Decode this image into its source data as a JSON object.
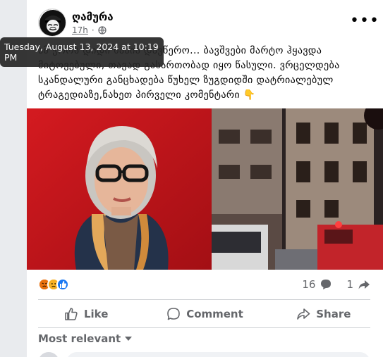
{
  "post": {
    "page_name": "ღამურა",
    "time": "17h",
    "text": "ამ ჭორს დიდი ხანია დავწერო... ბავშვები მარტო ჰყავდა მიტოვებული, თავად გასართობად იყო წასული. ვრცელდება სკანდალური განცხადება წუხელ ზუგდიდში დატრიალებულ ტრაგედიაზე,ნახეთ პირველი კომენტარი 👇",
    "tooltip": "Tuesday, August 13, 2024 at 10:19 PM"
  },
  "icons": {
    "avatar": "anonymous-mask-avatar",
    "privacy": "globe-icon",
    "more": "more-options-icon",
    "comment_count_icon": "comment-bubble-icon",
    "share_count_icon": "share-arrow-icon"
  },
  "stats": {
    "reactions": [
      "angry",
      "sad",
      "like"
    ],
    "comments": "16",
    "shares": "1"
  },
  "actions": {
    "like": "Like",
    "comment": "Comment",
    "share": "Share"
  },
  "comments": {
    "sort_label": "Most relevant"
  },
  "colors": {
    "accent": "#1877f2",
    "muted_text": "#65676b",
    "left_image_bg": "#c9161b"
  }
}
